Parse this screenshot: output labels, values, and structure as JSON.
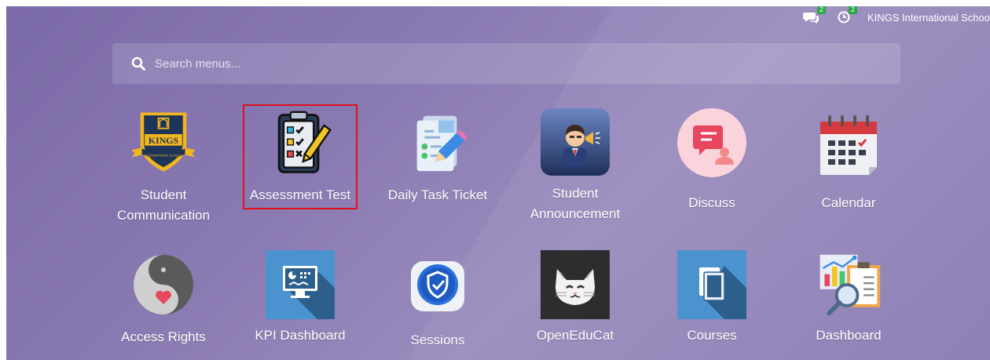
{
  "topbar": {
    "chat_count": "2",
    "activity_count": "2",
    "company_name": "KINGS International Schoo"
  },
  "search": {
    "placeholder": "Search menus..."
  },
  "apps": {
    "row1": [
      {
        "label": "Student Communication",
        "icon": "kings-shield-icon"
      },
      {
        "label": "Assessment Test",
        "icon": "checklist-clipboard-icon"
      },
      {
        "label": "Daily Task Ticket",
        "icon": "task-ticket-icon"
      },
      {
        "label": "Student Announcement",
        "icon": "megaphone-person-icon"
      },
      {
        "label": "Discuss",
        "icon": "discuss-icon"
      },
      {
        "label": "Calendar",
        "icon": "calendar-icon"
      }
    ],
    "row2": [
      {
        "label": "Access Rights",
        "icon": "yin-yang-gear-heart-icon"
      },
      {
        "label": "KPI Dashboard",
        "icon": "kpi-monitor-icon"
      },
      {
        "label": "Sessions",
        "icon": "shield-check-icon"
      },
      {
        "label": "OpenEduCat",
        "icon": "cat-face-icon"
      },
      {
        "label": "Courses",
        "icon": "folders-icon"
      },
      {
        "label": "Dashboard",
        "icon": "report-magnifier-icon"
      }
    ]
  },
  "kings_logo_text": "KINGS",
  "kings_logo_subtext": "INTERNATIONAL SCHOOL",
  "colors": {
    "highlight_border": "#e0101c",
    "badge": "#28a745",
    "background": "#8a7ab2"
  }
}
